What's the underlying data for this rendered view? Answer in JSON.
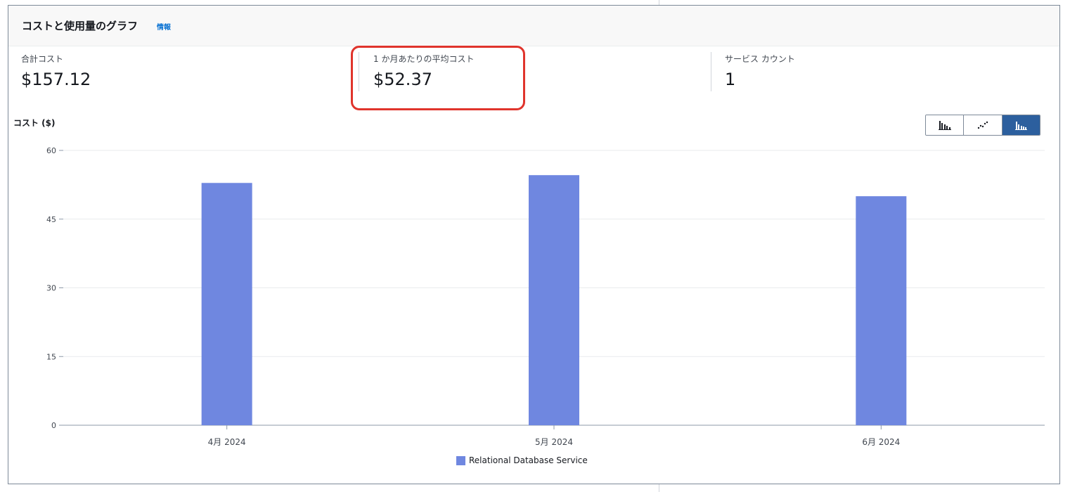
{
  "header": {
    "title": "コストと使用量のグラフ",
    "info_link": "情報"
  },
  "metrics": [
    {
      "label": "合計コスト",
      "value": "$157.12"
    },
    {
      "label": "1 か月あたりの平均コスト",
      "value": "$52.37"
    },
    {
      "label": "サービス カウント",
      "value": "1"
    }
  ],
  "chart_view_toggle": {
    "options": [
      "grouped-bar-chart-icon",
      "line-chart-icon",
      "stacked-bar-chart-icon"
    ],
    "selected": "stacked-bar-chart-icon"
  },
  "colors": {
    "series": "#6f87e0",
    "highlight": "#e0342c",
    "toggle_active": "#2c5f9e"
  },
  "chart_data": {
    "type": "bar",
    "ylabel": "コスト ($)",
    "categories": [
      "4月 2024",
      "5月 2024",
      "6月 2024"
    ],
    "series": [
      {
        "name": "Relational Database Service",
        "values": [
          52.9,
          54.6,
          50.0
        ]
      }
    ],
    "yticks": [
      0,
      15,
      30,
      45,
      60
    ],
    "ylim": [
      0,
      60
    ],
    "grid": true,
    "legend_position": "bottom"
  }
}
